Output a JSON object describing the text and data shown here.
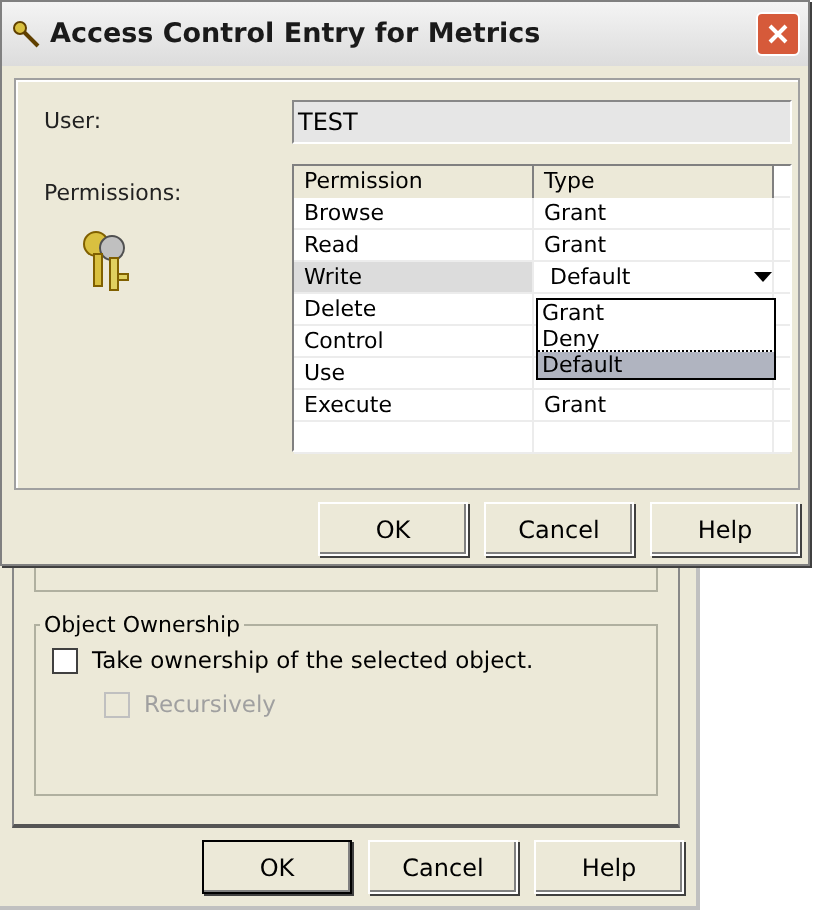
{
  "window": {
    "title": "Access Control Entry for Metrics"
  },
  "user": {
    "label": "User:",
    "value": "TEST"
  },
  "permissions": {
    "label": "Permissions:",
    "columns": [
      "Permission",
      "Type"
    ],
    "rows": [
      {
        "permission": "Browse",
        "type": "Grant",
        "selected": false
      },
      {
        "permission": "Read",
        "type": "Grant",
        "selected": false
      },
      {
        "permission": "Write",
        "type": "Default",
        "selected": true
      },
      {
        "permission": "Delete",
        "selected": false
      },
      {
        "permission": "Control",
        "selected": false
      },
      {
        "permission": "Use",
        "selected": false
      },
      {
        "permission": "Execute",
        "type": "Grant",
        "selected": false
      }
    ],
    "dropdown": [
      {
        "label": "Grant",
        "selected": false
      },
      {
        "label": "Deny",
        "selected": false
      },
      {
        "label": "Default",
        "selected": true
      }
    ]
  },
  "buttons": [
    {
      "label": "OK"
    },
    {
      "label": "Cancel"
    },
    {
      "label": "Help"
    }
  ],
  "back_dialog": {
    "group": {
      "title": "Object Ownership",
      "checkbox": {
        "label": "Take ownership of the selected object.",
        "checked": false
      },
      "sub_checkbox": {
        "label": "Recursively",
        "checked": false,
        "disabled": true
      }
    },
    "buttons": [
      {
        "label": "OK",
        "default": true
      },
      {
        "label": "Cancel",
        "default": false
      },
      {
        "label": "Help",
        "default": false
      }
    ]
  }
}
